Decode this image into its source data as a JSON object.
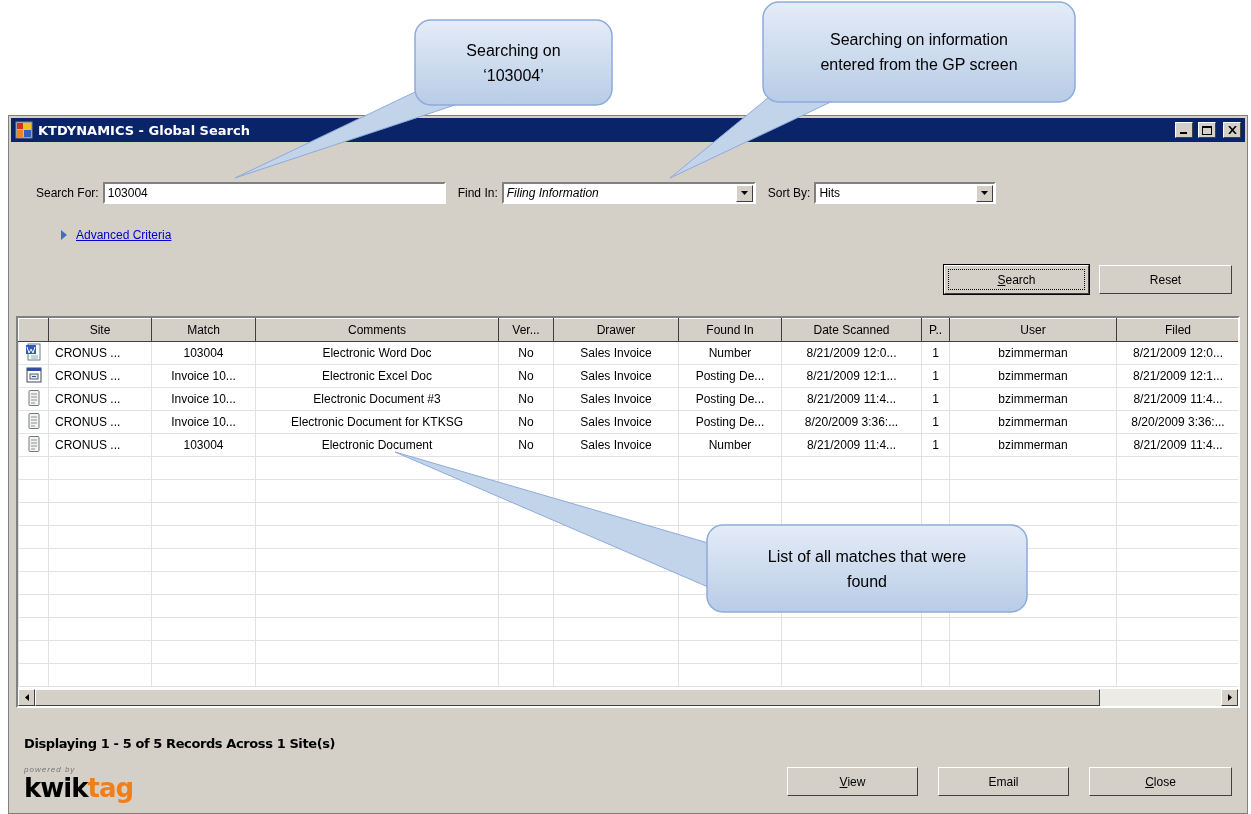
{
  "window": {
    "title": "KTDYNAMICS - Global Search"
  },
  "search": {
    "label": "Search For:",
    "value": "103004"
  },
  "find_in": {
    "label": "Find In:",
    "value": "Filing Information"
  },
  "sort_by": {
    "label": "Sort By:",
    "value": "Hits"
  },
  "advanced_link": {
    "label": "Advanced Criteria",
    "expanded": false
  },
  "action_buttons": [
    {
      "label": "Search",
      "mnemonic": true,
      "default": true
    },
    {
      "label": "Reset",
      "mnemonic": false,
      "default": false
    }
  ],
  "table": {
    "columns": [
      "Site",
      "Match",
      "Comments",
      "Ver...",
      "Drawer",
      "Found In",
      "Date Scanned",
      "P..",
      "User",
      "Filed"
    ],
    "rows": [
      {
        "kind": "word",
        "cells": [
          "CRONUS ...",
          "103004",
          "Electronic Word Doc",
          "No",
          "Sales Invoice",
          "Number",
          "8/21/2009 12:0...",
          "1",
          "bzimmerman",
          "8/21/2009 12:0..."
        ]
      },
      {
        "kind": "excel",
        "cells": [
          "CRONUS ...",
          "Invoice 10...",
          "Electronic Excel Doc",
          "No",
          "Sales Invoice",
          "Posting De...",
          "8/21/2009 12:1...",
          "1",
          "bzimmerman",
          "8/21/2009 12:1..."
        ]
      },
      {
        "kind": "text",
        "cells": [
          "CRONUS ...",
          "Invoice 10...",
          "Electronic Document #3",
          "No",
          "Sales Invoice",
          "Posting De...",
          "8/21/2009 11:4...",
          "1",
          "bzimmerman",
          "8/21/2009 11:4..."
        ]
      },
      {
        "kind": "text",
        "cells": [
          "CRONUS ...",
          "Invoice 10...",
          "Electronic Document for KTKSG",
          "No",
          "Sales Invoice",
          "Posting De...",
          "8/20/2009 3:36:...",
          "1",
          "bzimmerman",
          "8/20/2009 3:36:..."
        ]
      },
      {
        "kind": "text",
        "cells": [
          "CRONUS ...",
          "103004",
          "Electronic Document",
          "No",
          "Sales Invoice",
          "Number",
          "8/21/2009 11:4...",
          "1",
          "bzimmerman",
          "8/21/2009 11:4..."
        ]
      }
    ]
  },
  "status": "Displaying 1 - 5 of 5 Records Across 1 Site(s)",
  "logo": {
    "tagline": "powered by",
    "word_1": "kwik",
    "word_2": "tag"
  },
  "footer_buttons": [
    {
      "label": "View",
      "mnemonic": true
    },
    {
      "label": "Email",
      "mnemonic": false
    },
    {
      "label": "Close",
      "mnemonic": true
    }
  ],
  "callouts": [
    "Searching on ‘103004’",
    "Searching on information entered from the GP screen",
    "List of all matches that were found"
  ]
}
